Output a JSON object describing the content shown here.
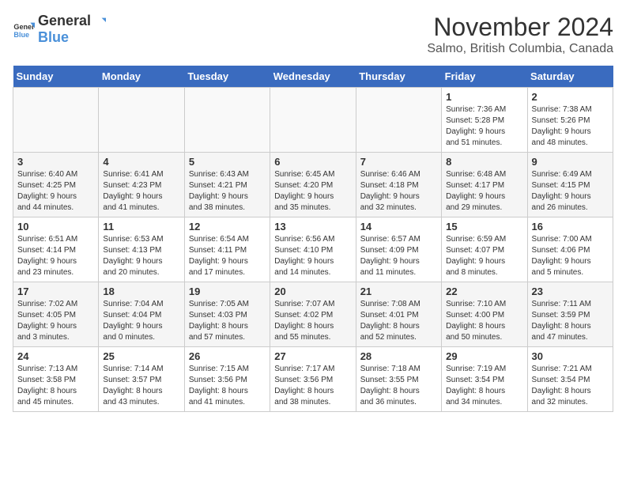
{
  "header": {
    "logo_general": "General",
    "logo_blue": "Blue",
    "month": "November 2024",
    "location": "Salmo, British Columbia, Canada"
  },
  "days_of_week": [
    "Sunday",
    "Monday",
    "Tuesday",
    "Wednesday",
    "Thursday",
    "Friday",
    "Saturday"
  ],
  "weeks": [
    [
      {
        "day": "",
        "info": ""
      },
      {
        "day": "",
        "info": ""
      },
      {
        "day": "",
        "info": ""
      },
      {
        "day": "",
        "info": ""
      },
      {
        "day": "",
        "info": ""
      },
      {
        "day": "1",
        "info": "Sunrise: 7:36 AM\nSunset: 5:28 PM\nDaylight: 9 hours\nand 51 minutes."
      },
      {
        "day": "2",
        "info": "Sunrise: 7:38 AM\nSunset: 5:26 PM\nDaylight: 9 hours\nand 48 minutes."
      }
    ],
    [
      {
        "day": "3",
        "info": "Sunrise: 6:40 AM\nSunset: 4:25 PM\nDaylight: 9 hours\nand 44 minutes."
      },
      {
        "day": "4",
        "info": "Sunrise: 6:41 AM\nSunset: 4:23 PM\nDaylight: 9 hours\nand 41 minutes."
      },
      {
        "day": "5",
        "info": "Sunrise: 6:43 AM\nSunset: 4:21 PM\nDaylight: 9 hours\nand 38 minutes."
      },
      {
        "day": "6",
        "info": "Sunrise: 6:45 AM\nSunset: 4:20 PM\nDaylight: 9 hours\nand 35 minutes."
      },
      {
        "day": "7",
        "info": "Sunrise: 6:46 AM\nSunset: 4:18 PM\nDaylight: 9 hours\nand 32 minutes."
      },
      {
        "day": "8",
        "info": "Sunrise: 6:48 AM\nSunset: 4:17 PM\nDaylight: 9 hours\nand 29 minutes."
      },
      {
        "day": "9",
        "info": "Sunrise: 6:49 AM\nSunset: 4:15 PM\nDaylight: 9 hours\nand 26 minutes."
      }
    ],
    [
      {
        "day": "10",
        "info": "Sunrise: 6:51 AM\nSunset: 4:14 PM\nDaylight: 9 hours\nand 23 minutes."
      },
      {
        "day": "11",
        "info": "Sunrise: 6:53 AM\nSunset: 4:13 PM\nDaylight: 9 hours\nand 20 minutes."
      },
      {
        "day": "12",
        "info": "Sunrise: 6:54 AM\nSunset: 4:11 PM\nDaylight: 9 hours\nand 17 minutes."
      },
      {
        "day": "13",
        "info": "Sunrise: 6:56 AM\nSunset: 4:10 PM\nDaylight: 9 hours\nand 14 minutes."
      },
      {
        "day": "14",
        "info": "Sunrise: 6:57 AM\nSunset: 4:09 PM\nDaylight: 9 hours\nand 11 minutes."
      },
      {
        "day": "15",
        "info": "Sunrise: 6:59 AM\nSunset: 4:07 PM\nDaylight: 9 hours\nand 8 minutes."
      },
      {
        "day": "16",
        "info": "Sunrise: 7:00 AM\nSunset: 4:06 PM\nDaylight: 9 hours\nand 5 minutes."
      }
    ],
    [
      {
        "day": "17",
        "info": "Sunrise: 7:02 AM\nSunset: 4:05 PM\nDaylight: 9 hours\nand 3 minutes."
      },
      {
        "day": "18",
        "info": "Sunrise: 7:04 AM\nSunset: 4:04 PM\nDaylight: 9 hours\nand 0 minutes."
      },
      {
        "day": "19",
        "info": "Sunrise: 7:05 AM\nSunset: 4:03 PM\nDaylight: 8 hours\nand 57 minutes."
      },
      {
        "day": "20",
        "info": "Sunrise: 7:07 AM\nSunset: 4:02 PM\nDaylight: 8 hours\nand 55 minutes."
      },
      {
        "day": "21",
        "info": "Sunrise: 7:08 AM\nSunset: 4:01 PM\nDaylight: 8 hours\nand 52 minutes."
      },
      {
        "day": "22",
        "info": "Sunrise: 7:10 AM\nSunset: 4:00 PM\nDaylight: 8 hours\nand 50 minutes."
      },
      {
        "day": "23",
        "info": "Sunrise: 7:11 AM\nSunset: 3:59 PM\nDaylight: 8 hours\nand 47 minutes."
      }
    ],
    [
      {
        "day": "24",
        "info": "Sunrise: 7:13 AM\nSunset: 3:58 PM\nDaylight: 8 hours\nand 45 minutes."
      },
      {
        "day": "25",
        "info": "Sunrise: 7:14 AM\nSunset: 3:57 PM\nDaylight: 8 hours\nand 43 minutes."
      },
      {
        "day": "26",
        "info": "Sunrise: 7:15 AM\nSunset: 3:56 PM\nDaylight: 8 hours\nand 41 minutes."
      },
      {
        "day": "27",
        "info": "Sunrise: 7:17 AM\nSunset: 3:56 PM\nDaylight: 8 hours\nand 38 minutes."
      },
      {
        "day": "28",
        "info": "Sunrise: 7:18 AM\nSunset: 3:55 PM\nDaylight: 8 hours\nand 36 minutes."
      },
      {
        "day": "29",
        "info": "Sunrise: 7:19 AM\nSunset: 3:54 PM\nDaylight: 8 hours\nand 34 minutes."
      },
      {
        "day": "30",
        "info": "Sunrise: 7:21 AM\nSunset: 3:54 PM\nDaylight: 8 hours\nand 32 minutes."
      }
    ]
  ]
}
